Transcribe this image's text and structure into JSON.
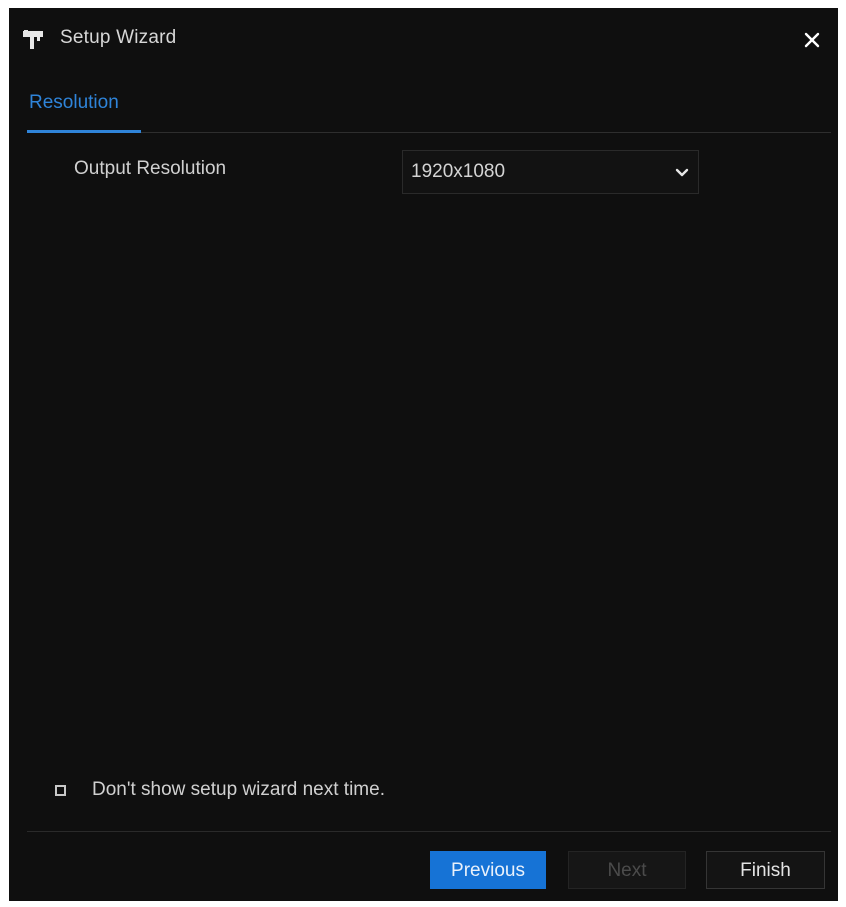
{
  "window": {
    "title": "Setup Wizard",
    "icon": "wizard-icon",
    "close_icon": "close-icon"
  },
  "tabs": [
    {
      "label": "Resolution",
      "active": true
    }
  ],
  "settings": {
    "output_resolution": {
      "label": "Output Resolution",
      "value": "1920x1080",
      "icon": "chevron-down-icon"
    }
  },
  "options": {
    "dont_show_again": {
      "label": "Don't show setup wizard next time.",
      "checked": false
    }
  },
  "footer": {
    "previous_label": "Previous",
    "next_label": "Next",
    "finish_label": "Finish"
  },
  "colors": {
    "background": "#0f0f0f",
    "accent": "#2f84d9",
    "primary_button": "#1673d6"
  }
}
